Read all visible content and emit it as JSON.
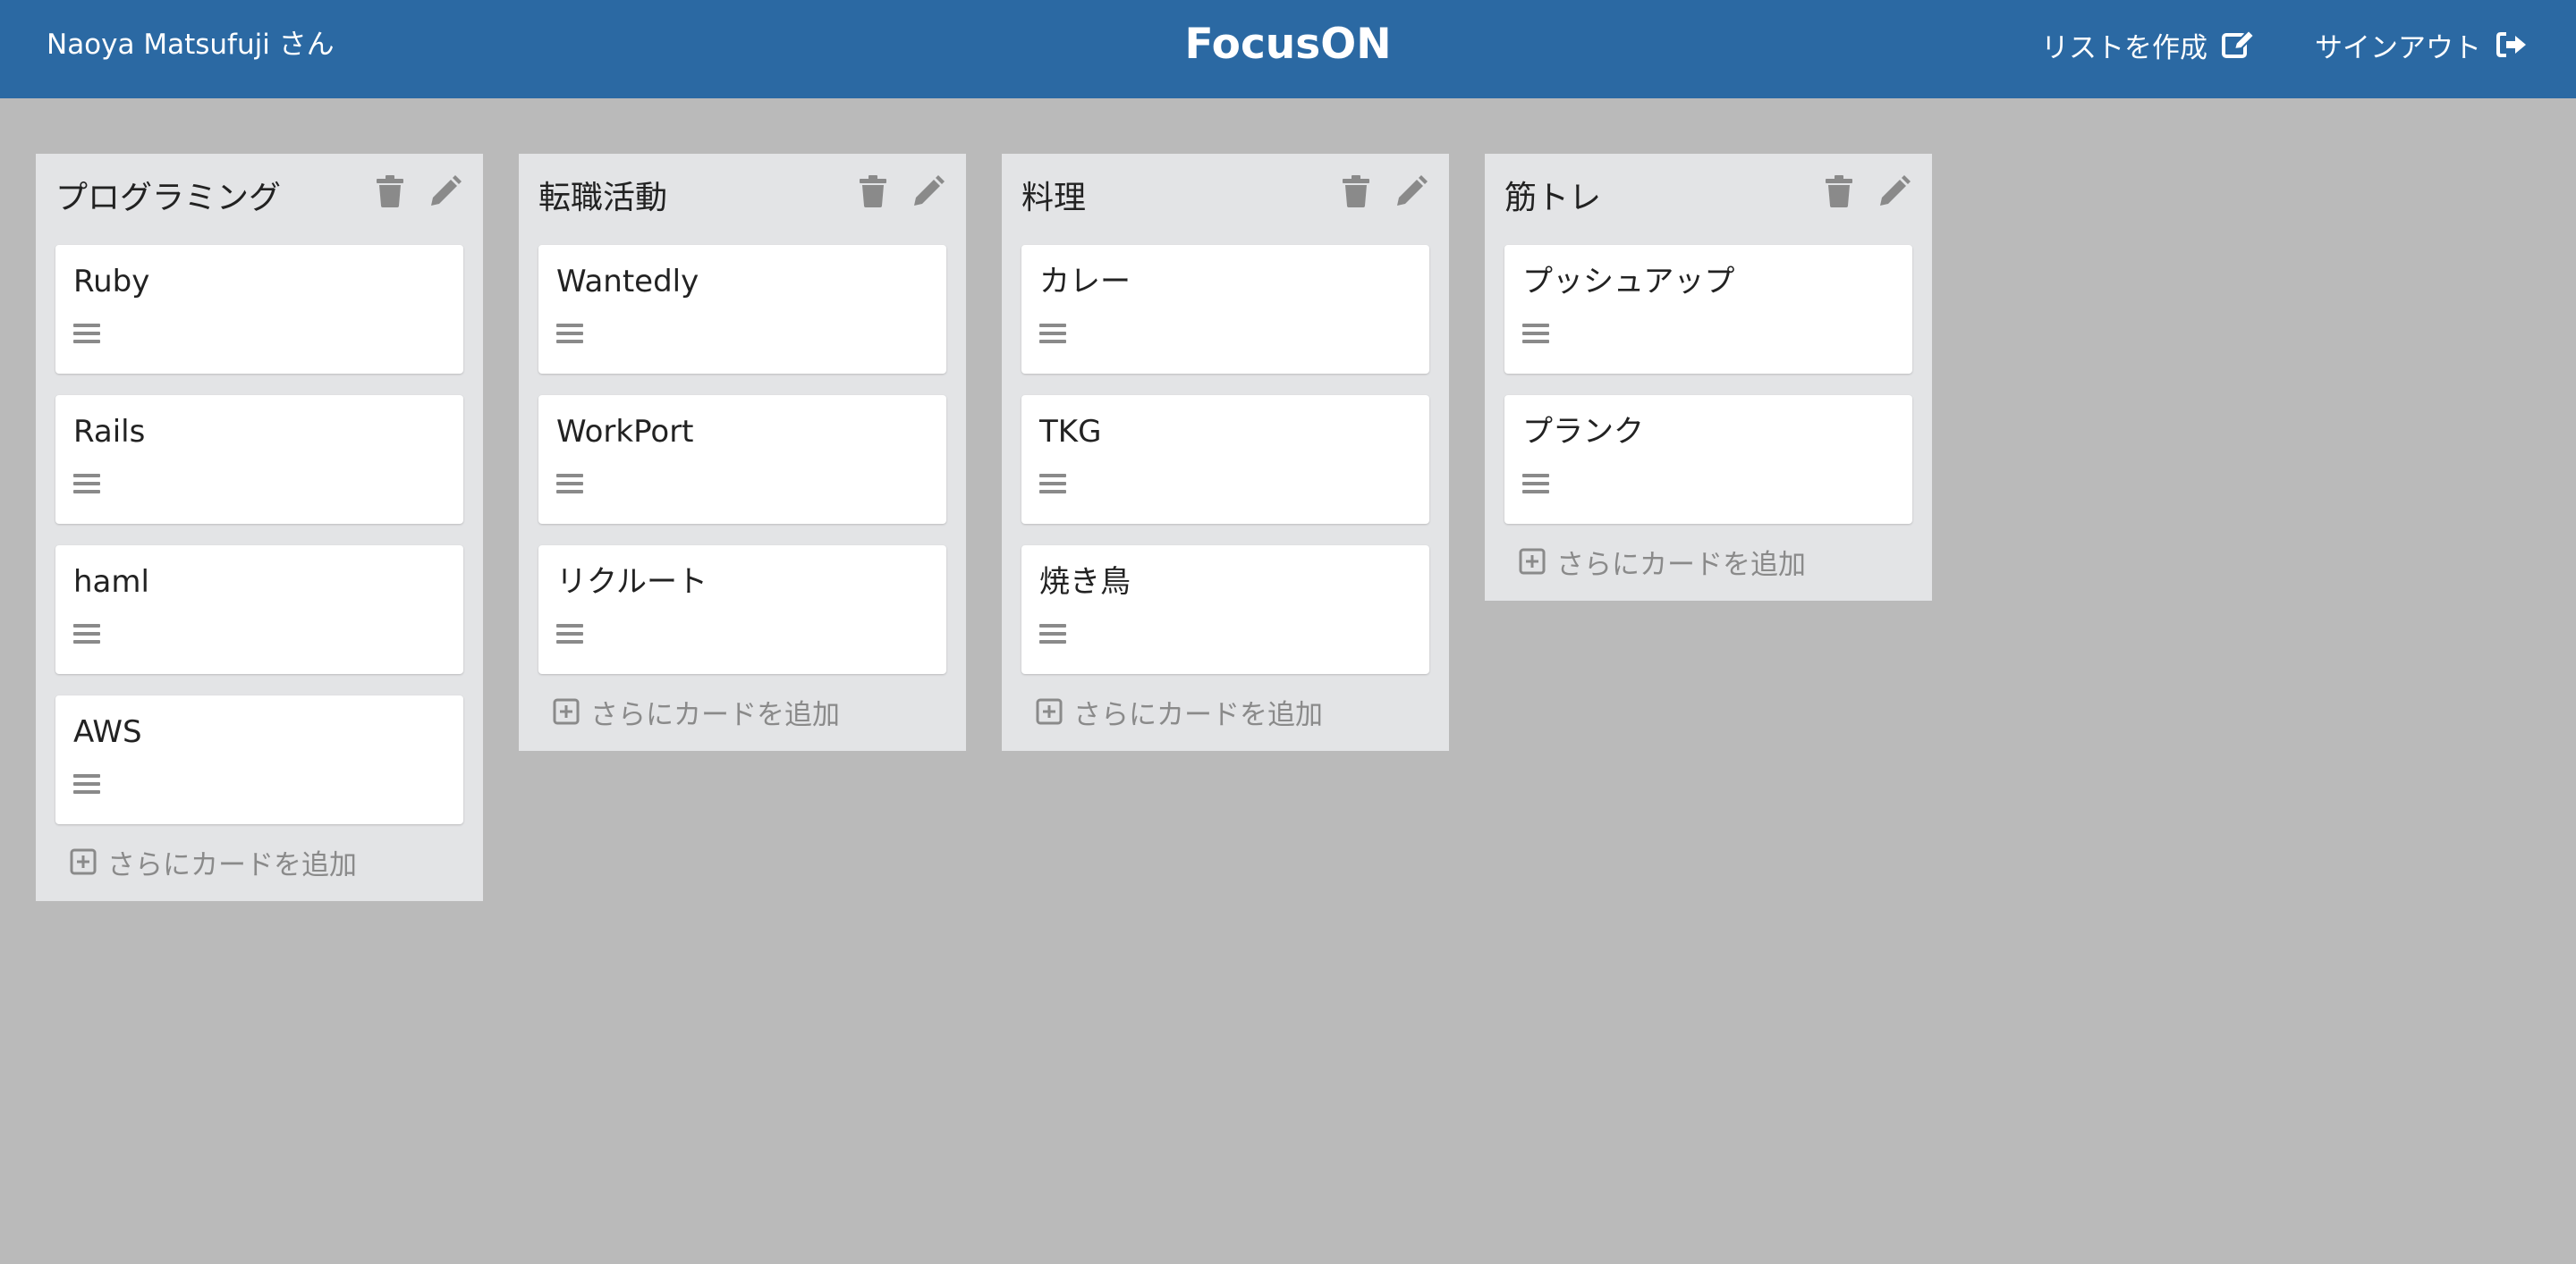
{
  "header": {
    "user": "Naoya Matsufuji さん",
    "title": "FocusON",
    "create_list": "リストを作成",
    "signout": "サインアウト"
  },
  "colors": {
    "header_bg": "#2b69a3",
    "page_bg": "#bababa",
    "list_bg": "#e3e4e6",
    "card_bg": "#ffffff",
    "icon_gray": "#8a8a8a"
  },
  "add_card_label": "さらにカードを追加",
  "lists": [
    {
      "title": "プログラミング",
      "cards": [
        {
          "title": "Ruby"
        },
        {
          "title": "Rails"
        },
        {
          "title": "haml"
        },
        {
          "title": "AWS"
        }
      ]
    },
    {
      "title": "転職活動",
      "cards": [
        {
          "title": "Wantedly"
        },
        {
          "title": "WorkPort"
        },
        {
          "title": "リクルート"
        }
      ]
    },
    {
      "title": "料理",
      "cards": [
        {
          "title": "カレー"
        },
        {
          "title": "TKG"
        },
        {
          "title": "焼き鳥"
        }
      ]
    },
    {
      "title": "筋トレ",
      "cards": [
        {
          "title": "プッシュアップ"
        },
        {
          "title": "プランク"
        }
      ]
    }
  ],
  "icons": {
    "create_list": "edit-icon",
    "signout": "sign-out-icon",
    "delete": "trash-icon",
    "edit": "pencil-icon",
    "card_menu": "menu-lines-icon",
    "add_card": "plus-square-icon"
  }
}
